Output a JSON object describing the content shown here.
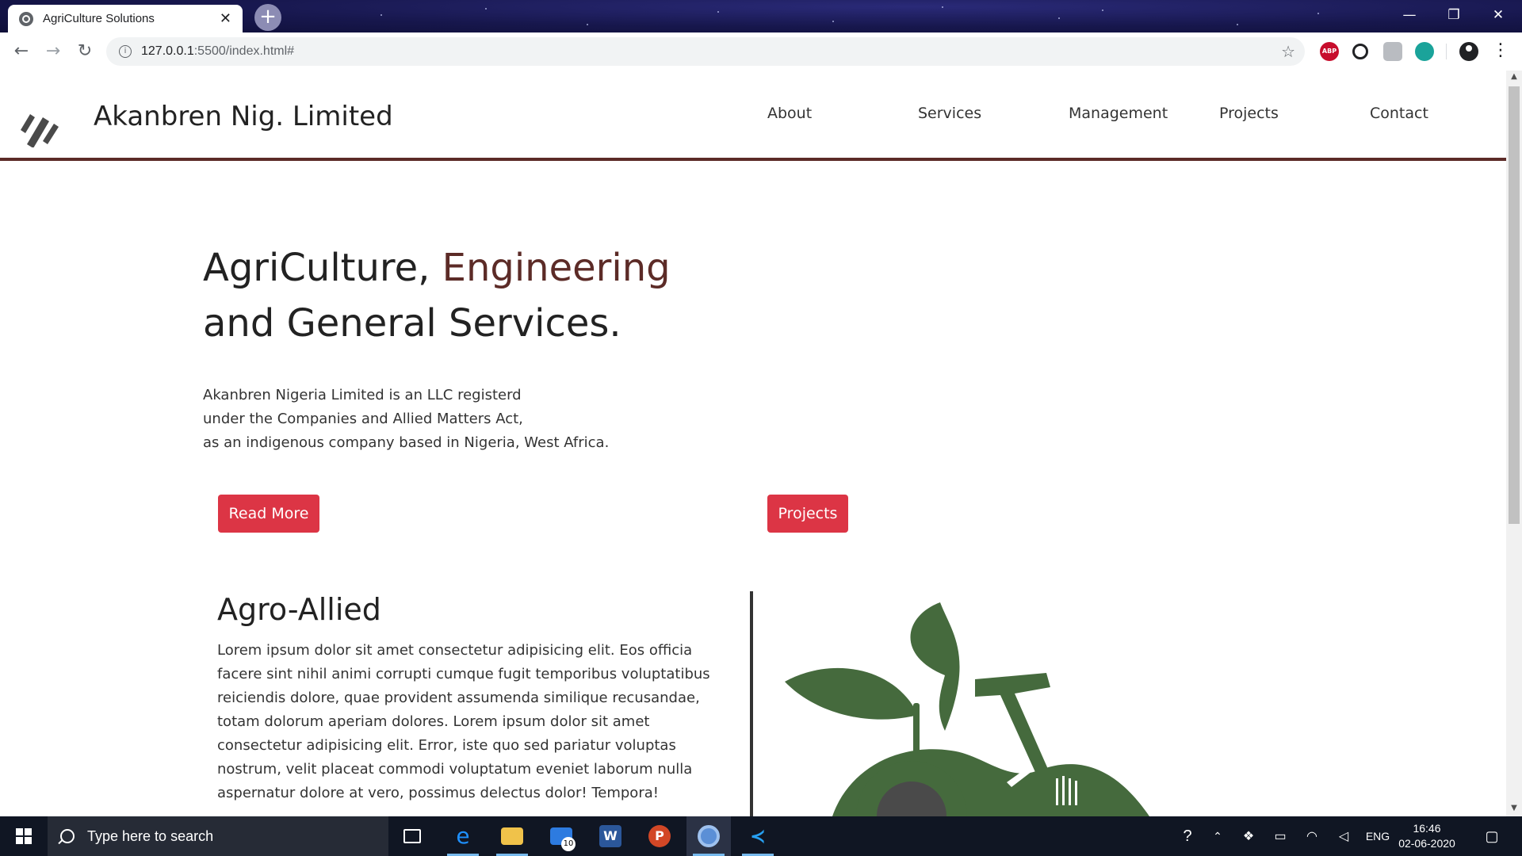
{
  "browser": {
    "tab_title": "AgriCulture Solutions",
    "tab_close": "✕",
    "new_tab": "+",
    "url_host": "127.0.0.1",
    "url_rest": ":5500/index.html#",
    "window_controls": {
      "minimize": "—",
      "restore": "❐",
      "close": "✕"
    },
    "nav": {
      "back": "←",
      "forward": "→",
      "reload": "↻"
    },
    "extensions": [
      "ABP",
      "ext-2",
      "ext-3",
      "ext-4"
    ]
  },
  "site": {
    "brand": "Akanbren Nig. Limited",
    "nav": [
      "About",
      "Services",
      "Management",
      "Projects",
      "Contact"
    ],
    "accent_color": "#5c2b27",
    "button_color": "#dc3545"
  },
  "hero": {
    "title_part1": "AgriCulture, ",
    "title_accent": "Engineering",
    "title_line2": "and General Services.",
    "desc_lines": [
      "Akanbren Nigeria Limited is an LLC registerd",
      "under the Companies and Allied Matters Act,",
      "as an indigenous company based in Nigeria, West Africa."
    ],
    "read_more": "Read More",
    "projects": "Projects"
  },
  "section": {
    "title": "Agro-Allied",
    "text": "Lorem ipsum dolor sit amet consectetur adipisicing elit. Eos officia facere sint nihil animi corrupti cumque fugit temporibus voluptatibus reiciendis dolore, quae provident assumenda similique recusandae, totam dolorum aperiam dolores. Lorem ipsum dolor sit amet consectetur adipisicing elit. Error, iste quo sed pariatur voluptas nostrum, velit placeat commodi voluptatum eveniet laborum nulla aspernatur dolore at vero, possimus delectus dolor! Tempora!",
    "graphic_color": "#456a3d"
  },
  "taskbar": {
    "search_placeholder": "Type here to search",
    "mail_badge": "10",
    "language": "ENG",
    "time": "16:46",
    "date": "02-06-2020"
  }
}
